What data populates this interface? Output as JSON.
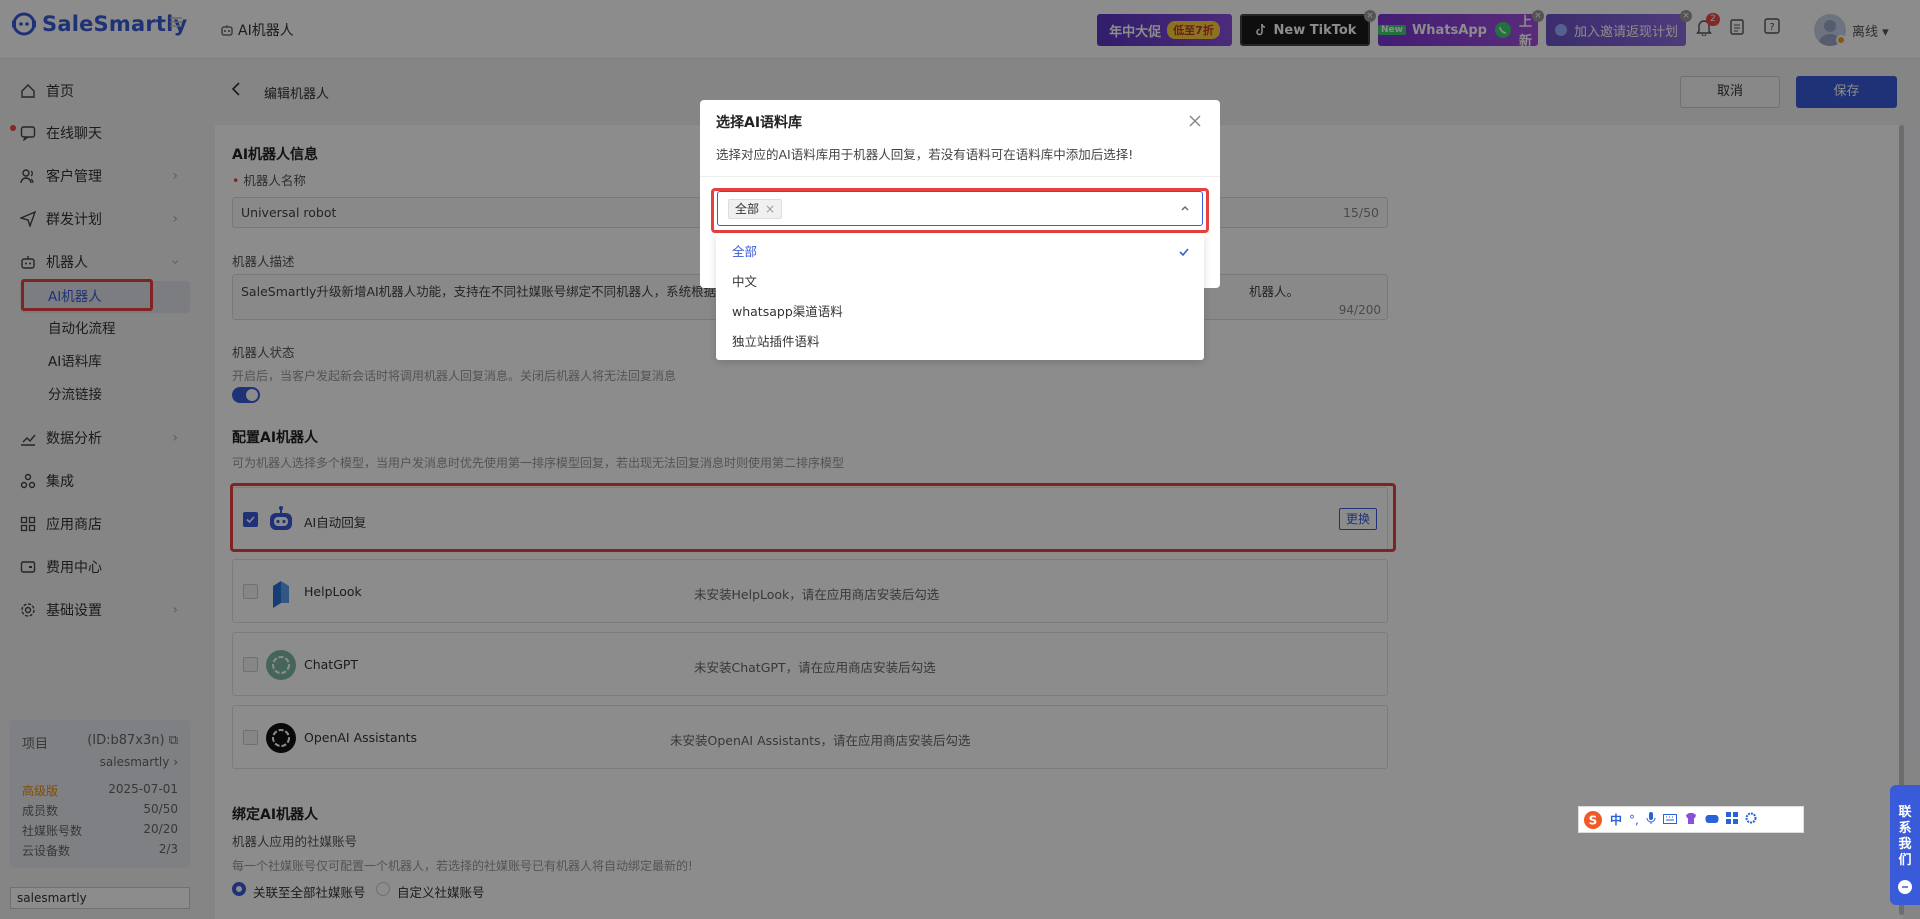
{
  "app": {
    "name": "SaleSmartly",
    "page_title": "AI机器人"
  },
  "banners": [
    {
      "text": "年中大促",
      "badge": "低至7折",
      "bg": "#6b3fc9"
    },
    {
      "text": "New TikTok",
      "bg": "#1b1b1b"
    },
    {
      "text": "WhatsApp",
      "new_tag": "New",
      "suffix": "上新",
      "bg": "#8a3fd6"
    },
    {
      "text": "加入邀请返现计划",
      "bg": "#7a55c9"
    }
  ],
  "header": {
    "notification_count": "2",
    "status": "离线"
  },
  "sidebar": {
    "items": [
      {
        "label": "首页",
        "icon": "home-icon"
      },
      {
        "label": "在线聊天",
        "icon": "chat-icon"
      },
      {
        "label": "客户管理",
        "icon": "users-icon"
      },
      {
        "label": "群发计划",
        "icon": "send-icon"
      },
      {
        "label": "机器人",
        "icon": "robot-icon"
      },
      {
        "label": "数据分析",
        "icon": "chart-icon"
      },
      {
        "label": "集成",
        "icon": "integration-icon"
      },
      {
        "label": "应用商店",
        "icon": "apps-icon"
      },
      {
        "label": "费用中心",
        "icon": "wallet-icon"
      },
      {
        "label": "基础设置",
        "icon": "gear-icon"
      }
    ],
    "robot_sub": [
      "AI机器人",
      "自动化流程",
      "AI语料库",
      "分流链接"
    ],
    "project": {
      "label": "项目",
      "id": "(ID:b87x3n)",
      "name": "salesmartly",
      "plan": "高级版",
      "expire": "2025-07-01",
      "rows": [
        {
          "k": "成员数",
          "v": "50/50"
        },
        {
          "k": "社媒账号数",
          "v": "20/20"
        },
        {
          "k": "云设备数",
          "v": "2/3"
        }
      ],
      "switch_value": "salesmartly"
    }
  },
  "main": {
    "back_title": "编辑机器人",
    "cancel": "取消",
    "save": "保存",
    "info_title": "AI机器人信息",
    "name_label": "机器人名称",
    "name_value": "Universal robot",
    "name_count": "15/50",
    "desc_label": "机器人描述",
    "desc_value": "SaleSmartly升级新增AI机器人功能，支持在不同社媒账号绑定不同机器人，系统根据您",
    "desc_value_tail": "机器人。",
    "desc_count": "94/200",
    "status_label": "机器人状态",
    "status_hint": "开启后，当客户发起新会话时将调用机器人回复消息。关闭后机器人将无法回复消息",
    "config_title": "配置AI机器人",
    "config_hint": "可为机器人选择多个模型，当用户发消息时优先使用第一排序模型回复，若出现无法回复消息时则使用第二排序模型",
    "models": [
      {
        "name": "AI自动回复",
        "note": "",
        "action": "更换"
      },
      {
        "name": "HelpLook",
        "note": "未安装HelpLook，请在应用商店安装后勾选"
      },
      {
        "name": "ChatGPT",
        "note": "未安装ChatGPT，请在应用商店安装后勾选"
      },
      {
        "name": "OpenAI Assistants",
        "note": "未安装OpenAI Assistants，请在应用商店安装后勾选"
      }
    ],
    "bind_title": "绑定AI机器人",
    "bind_label": "机器人应用的社媒账号",
    "bind_hint": "每一个社媒账号仅可配置一个机器人，若选择的社媒账号已有机器人将自动绑定最新的!",
    "bind_options": [
      "关联至全部社媒账号",
      "自定义社媒账号"
    ]
  },
  "modal": {
    "title": "选择AI语料库",
    "desc": "选择对应的AI语料库用于机器人回复，若没有语料可在语料库中添加后选择!",
    "selected_tag": "全部",
    "options": [
      "全部",
      "中文",
      "whatsapp渠道语料",
      "独立站插件语料"
    ],
    "selected_index": 0
  },
  "floating": {
    "contact": "联系我们",
    "ime_char": "中"
  },
  "colors": {
    "accent": "#3a5bd9",
    "highlight": "#e84040"
  }
}
